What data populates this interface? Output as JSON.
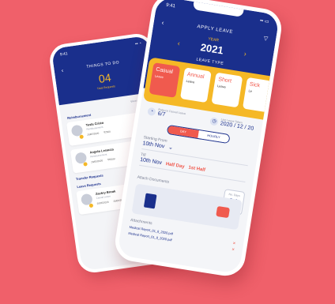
{
  "background_color": "#F0606A",
  "colors": {
    "brand": "#1A2F8C",
    "accent": "#F5B826",
    "highlight": "#F05A4E"
  },
  "back_phone": {
    "status_time": "9:41",
    "title": "THINGS TO DO",
    "count": "04",
    "count_label": "Total Requests",
    "view_all": "View All Requests",
    "section_reimbursement": "Reimbursement",
    "section_transfer": "Transfer Requests",
    "section_leave": "Leave Requests",
    "cards": [
      {
        "name": "Tesla Cristo",
        "note": "Reimbursement",
        "date": "20/05/2020",
        "amount": "₹2500"
      },
      {
        "name": "Angelo Lesauza",
        "note": "Reimbursement",
        "date": "20/05/2020",
        "amount": "₹5500/-"
      },
      {
        "name": "Zackry Brook",
        "note": "Casual Leave",
        "date": "20/05/2020",
        "amount": "20/05/2020"
      }
    ]
  },
  "front_phone": {
    "status_time": "9:41",
    "title": "APPLY LEAVE",
    "year_label": "YEAR",
    "year": "2021",
    "leave_type_label": "LEAVE TYPE",
    "leave_types": [
      {
        "name": "Casual",
        "sub": "Leave"
      },
      {
        "name": "Annual",
        "sub": "Leave"
      },
      {
        "name": "Short",
        "sub": "Leave"
      },
      {
        "name": "Sick",
        "sub": "Le"
      }
    ],
    "balance_label": "Balance Casual Leave",
    "balance_value": "6/7",
    "last_taken_label": "Last Leave Taken",
    "last_taken_value": "2020 / 12 / 20",
    "duration_options": [
      "DAY",
      "HOURLY"
    ],
    "starting_label": "Starting From",
    "starting_date": "10th Nov",
    "till_label": "Till",
    "till_date": "10th Nov",
    "half_day": "Half Day",
    "first_half": "1st Half",
    "no_days_label": "No. Days",
    "no_days_value": "01",
    "attach_label": "Attach Documents",
    "attachments_label": "Attachments",
    "attachments": [
      "Medical Report_01_8_2020.pdf",
      "Medical Report_01_8_2020.pdf"
    ]
  }
}
